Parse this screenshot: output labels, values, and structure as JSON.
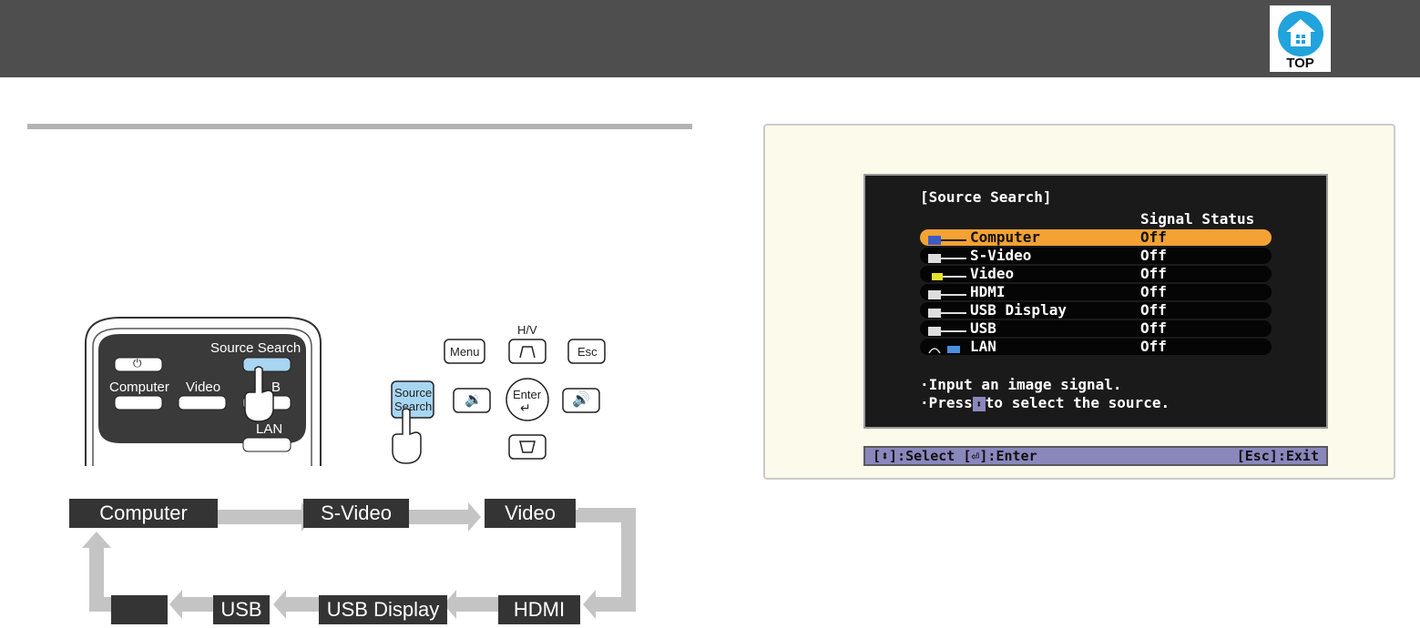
{
  "header": {
    "top_button_label": "TOP",
    "top_icon": "home-icon"
  },
  "remote": {
    "power_icon": "power-icon",
    "source_search_label": "Source Search",
    "computer_label": "Computer",
    "video_label": "Video",
    "usb_label_partial": "B",
    "lan_label": "LAN",
    "pointer_icon": "hand-pointer-icon"
  },
  "control_panel": {
    "menu_label": "Menu",
    "hv_label": "H/V",
    "esc_label": "Esc",
    "source_label_line1": "Source",
    "source_label_line2": "Search",
    "enter_label": "Enter",
    "volume_down_icon": "volume-down-icon",
    "volume_up_icon": "volume-up-icon",
    "keystone_icon": "keystone-icon",
    "pointer_icon": "hand-pointer-icon"
  },
  "flow": {
    "boxes": [
      "Computer",
      "S-Video",
      "Video",
      "HDMI",
      "USB Display",
      "USB",
      ""
    ]
  },
  "osd": {
    "title": "[Source Search]",
    "status_header": "Signal Status",
    "rows": [
      {
        "name": "Computer",
        "status": "Off",
        "icon": "computer-port-icon",
        "selected": true
      },
      {
        "name": "S-Video",
        "status": "Off",
        "icon": "svideo-port-icon",
        "selected": false
      },
      {
        "name": "Video",
        "status": "Off",
        "icon": "video-port-icon",
        "selected": false
      },
      {
        "name": "HDMI",
        "status": "Off",
        "icon": "hdmi-port-icon",
        "selected": false
      },
      {
        "name": "USB Display",
        "status": "Off",
        "icon": "usb-display-port-icon",
        "selected": false
      },
      {
        "name": "USB",
        "status": "Off",
        "icon": "usb-port-icon",
        "selected": false
      },
      {
        "name": "LAN",
        "status": "Off",
        "icon": "lan-wireless-icon",
        "selected": false
      }
    ],
    "message_line1": "·Input an image signal.",
    "message_line2_pre": "·Press",
    "message_line2_post": "to select the source.",
    "help_left": "[⬍]:Select  [⏎]:Enter",
    "help_right": "[Esc]:Exit"
  },
  "colors": {
    "header_bg": "#4e4e4e",
    "top_icon_blue": "#21a3dc",
    "highlight_orange": "#f4a233",
    "help_bar": "#8a87bd",
    "note_bg": "#fcfaea"
  }
}
